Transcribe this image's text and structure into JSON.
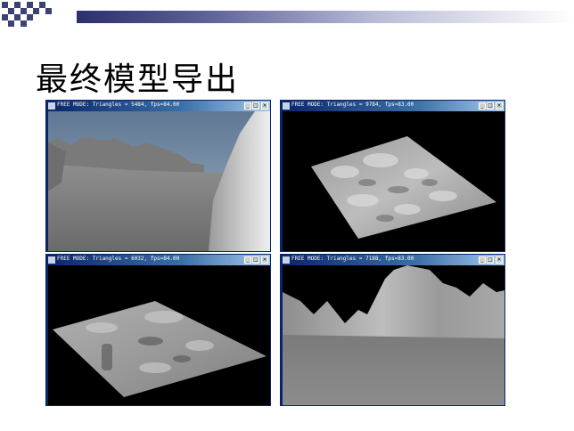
{
  "slide": {
    "title": "最终模型导出",
    "colors": {
      "accent_bar": "#2a2f6e",
      "checker": "#3d4275",
      "window_titlebar": "#0a246a"
    }
  },
  "windows": [
    {
      "title": "FREE MODE: Triangles = 5484, fps=84.00",
      "view": "ground-level terrain with sky"
    },
    {
      "title": "FREE MODE: Triangles = 9784, fps=83.00",
      "view": "aerial terrain patch"
    },
    {
      "title": "FREE MODE: Triangles = 6032, fps=84.00",
      "view": "aerial terrain patch"
    },
    {
      "title": "FREE MODE: Triangles = 7188, fps=83.00",
      "view": "ground-level terrain"
    }
  ],
  "window_controls": {
    "minimize": "_",
    "maximize": "□",
    "close": "×"
  }
}
